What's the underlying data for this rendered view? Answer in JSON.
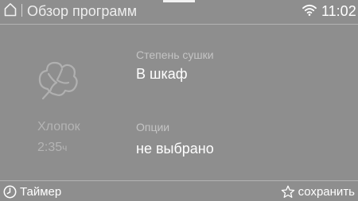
{
  "header": {
    "title": "Обзор программ",
    "time": "11:02",
    "icons": {
      "home": "home-icon",
      "wifi": "wifi-icon"
    }
  },
  "program": {
    "name": "Хлопок",
    "duration_value": "2:35",
    "duration_unit": "ч",
    "icon": "cotton-flower-icon"
  },
  "fields": {
    "drying_label": "Степень сушки",
    "drying_value": "В шкаф",
    "options_label": "Опции",
    "options_value": "не выбрано"
  },
  "footer": {
    "timer_label": "Таймер",
    "timer_icon": "clock-icon",
    "save_label": "сохранить",
    "save_icon": "star-icon"
  },
  "colors": {
    "background": "#8e8e8e",
    "text_primary": "#ffffff",
    "text_muted": "#b4b4b4"
  }
}
